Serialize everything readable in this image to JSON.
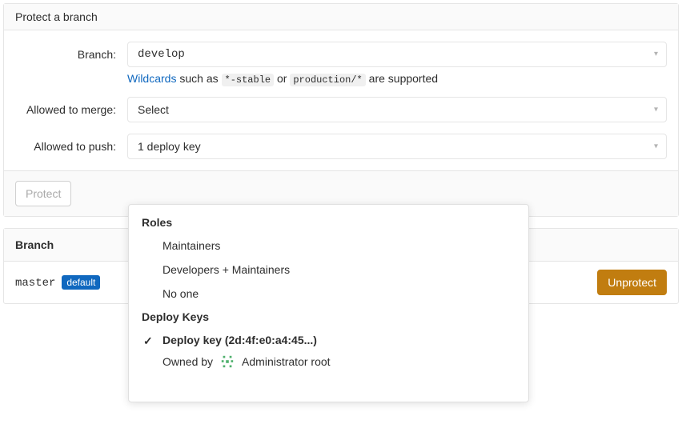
{
  "panel_title": "Protect a branch",
  "form": {
    "branch_label": "Branch:",
    "branch_value": "develop",
    "wildcards_link": "Wildcards",
    "wildcards_mid1": " such as ",
    "wildcards_code1": "*-stable",
    "wildcards_mid2": " or ",
    "wildcards_code2": "production/*",
    "wildcards_mid3": " are supported",
    "merge_label": "Allowed to merge:",
    "merge_value": "Select",
    "push_label": "Allowed to push:",
    "push_value": "1 deploy key"
  },
  "protect_button": "Protect",
  "dropdown": {
    "roles_title": "Roles",
    "role_maintainers": "Maintainers",
    "role_dev_maint": "Developers + Maintainers",
    "role_noone": "No one",
    "deploy_keys_title": "Deploy Keys",
    "deploy_key_label": "Deploy key (2d:4f:e0:a4:45...)",
    "owned_by_prefix": "Owned by",
    "owned_by_name": "Administrator root"
  },
  "table": {
    "header": "Branch",
    "row_branch": "master",
    "row_badge": "default",
    "unprotect": "Unprotect"
  }
}
